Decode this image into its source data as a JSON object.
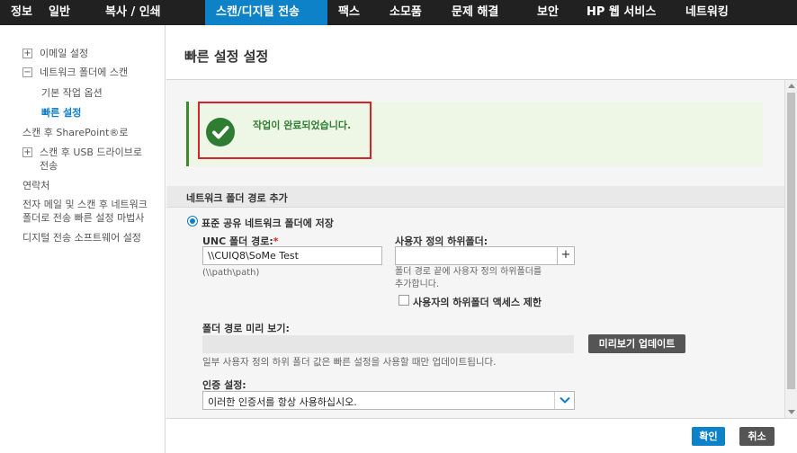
{
  "topnav": {
    "tabs": [
      {
        "label": "정보"
      },
      {
        "label": "일반"
      },
      {
        "label": "복사 / 인쇄"
      },
      {
        "label": "스캔/디지털 전송",
        "active": true
      },
      {
        "label": "팩스"
      },
      {
        "label": "소모품"
      },
      {
        "label": "문제 해결"
      },
      {
        "label": "보안"
      },
      {
        "label": "HP 웹 서비스"
      },
      {
        "label": "네트워킹"
      }
    ]
  },
  "sidebar": {
    "items": [
      {
        "label": "이메일 설정",
        "toggle": "+"
      },
      {
        "label": "네트워크 폴더에 스캔",
        "toggle": "−"
      },
      {
        "label": "기본 작업 옵션"
      },
      {
        "label": "빠른 설정",
        "active": true
      },
      {
        "label": "스캔 후 SharePoint®로"
      },
      {
        "label": "스캔 후 USB 드라이브로",
        "label2": "전송",
        "toggle": "+"
      },
      {
        "label": "연락처"
      },
      {
        "label": "전자 메일 및 스캔 후 네트워크",
        "label2": "폴더로 전송 빠른 설정 마법사"
      },
      {
        "label": "디지털 전송 소프트웨어 설정"
      }
    ]
  },
  "main": {
    "title": "빠른 설정 설정",
    "success_message": "작업이 완료되었습니다.",
    "section_title": "네트워크 폴더 경로 추가",
    "radio_label": "표준 공유 네트워크 폴더에 저장",
    "unc_label": "UNC 폴더 경로:",
    "unc_required": "*",
    "unc_value": "\\\\CUIQ8\\SoMe Test",
    "unc_hint": "(\\\\path\\path)",
    "subfolder_label": "사용자 정의 하위폴더:",
    "subfolder_value": "",
    "subfolder_add": "+",
    "subfolder_hint1": "폴더 경로 끝에 사용자 정의 하위폴더를",
    "subfolder_hint2": "추가합니다.",
    "restrict_label": "사용자의 하위폴더 액세스 제한",
    "preview_label": "폴더 경로 미리 보기:",
    "preview_button": "미리보기 업데이트",
    "preview_note": "일부 사용자 정의 하위 폴더 값은 빠른 설정을 사용할 때만 업데이트됩니다.",
    "auth_label": "인증 설정:",
    "auth_value": "이러한 인증서를 항상 사용하십시오."
  },
  "footer": {
    "ok": "확인",
    "cancel": "취소"
  },
  "colors": {
    "nav_bg": "#212121",
    "accent": "#0e82c8",
    "success": "#2e7d32",
    "highlight": "#d9232a"
  }
}
